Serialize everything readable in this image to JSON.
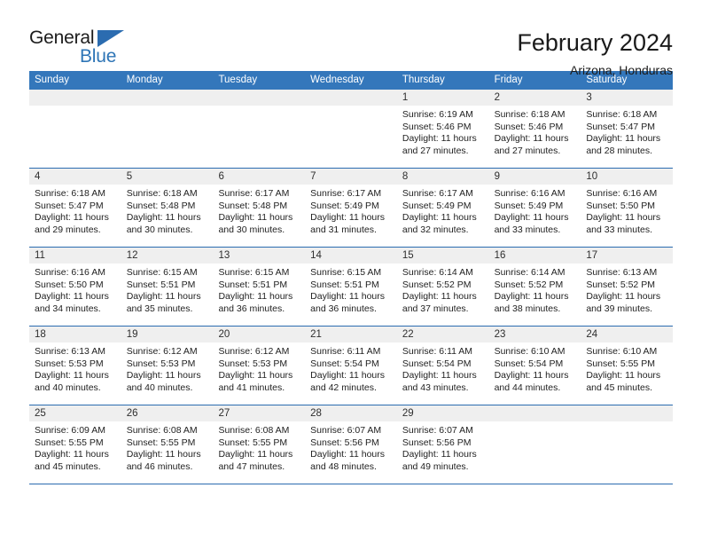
{
  "brand": {
    "name_part1": "General",
    "name_part2": "Blue",
    "triangle_color": "#2b6cb0",
    "blue_color": "#2e75b6"
  },
  "header": {
    "title": "February 2024",
    "subtitle": "Arizona, Honduras"
  },
  "theme": {
    "header_bar": "#3477bb",
    "row_divider": "#2b6cb0",
    "date_band": "#efefef",
    "text": "#222222"
  },
  "weekdays": [
    "Sunday",
    "Monday",
    "Tuesday",
    "Wednesday",
    "Thursday",
    "Friday",
    "Saturday"
  ],
  "labels": {
    "sunrise_prefix": "Sunrise:",
    "sunset_prefix": "Sunset:",
    "daylight_prefix": "Daylight:"
  },
  "weeks": [
    [
      {
        "day": "",
        "empty": true
      },
      {
        "day": "",
        "empty": true
      },
      {
        "day": "",
        "empty": true
      },
      {
        "day": "",
        "empty": true
      },
      {
        "day": "1",
        "sunrise": "Sunrise: 6:19 AM",
        "sunset": "Sunset: 5:46 PM",
        "daylight_line1": "Daylight: 11 hours",
        "daylight_line2": "and 27 minutes."
      },
      {
        "day": "2",
        "sunrise": "Sunrise: 6:18 AM",
        "sunset": "Sunset: 5:46 PM",
        "daylight_line1": "Daylight: 11 hours",
        "daylight_line2": "and 27 minutes."
      },
      {
        "day": "3",
        "sunrise": "Sunrise: 6:18 AM",
        "sunset": "Sunset: 5:47 PM",
        "daylight_line1": "Daylight: 11 hours",
        "daylight_line2": "and 28 minutes."
      }
    ],
    [
      {
        "day": "4",
        "sunrise": "Sunrise: 6:18 AM",
        "sunset": "Sunset: 5:47 PM",
        "daylight_line1": "Daylight: 11 hours",
        "daylight_line2": "and 29 minutes."
      },
      {
        "day": "5",
        "sunrise": "Sunrise: 6:18 AM",
        "sunset": "Sunset: 5:48 PM",
        "daylight_line1": "Daylight: 11 hours",
        "daylight_line2": "and 30 minutes."
      },
      {
        "day": "6",
        "sunrise": "Sunrise: 6:17 AM",
        "sunset": "Sunset: 5:48 PM",
        "daylight_line1": "Daylight: 11 hours",
        "daylight_line2": "and 30 minutes."
      },
      {
        "day": "7",
        "sunrise": "Sunrise: 6:17 AM",
        "sunset": "Sunset: 5:49 PM",
        "daylight_line1": "Daylight: 11 hours",
        "daylight_line2": "and 31 minutes."
      },
      {
        "day": "8",
        "sunrise": "Sunrise: 6:17 AM",
        "sunset": "Sunset: 5:49 PM",
        "daylight_line1": "Daylight: 11 hours",
        "daylight_line2": "and 32 minutes."
      },
      {
        "day": "9",
        "sunrise": "Sunrise: 6:16 AM",
        "sunset": "Sunset: 5:49 PM",
        "daylight_line1": "Daylight: 11 hours",
        "daylight_line2": "and 33 minutes."
      },
      {
        "day": "10",
        "sunrise": "Sunrise: 6:16 AM",
        "sunset": "Sunset: 5:50 PM",
        "daylight_line1": "Daylight: 11 hours",
        "daylight_line2": "and 33 minutes."
      }
    ],
    [
      {
        "day": "11",
        "sunrise": "Sunrise: 6:16 AM",
        "sunset": "Sunset: 5:50 PM",
        "daylight_line1": "Daylight: 11 hours",
        "daylight_line2": "and 34 minutes."
      },
      {
        "day": "12",
        "sunrise": "Sunrise: 6:15 AM",
        "sunset": "Sunset: 5:51 PM",
        "daylight_line1": "Daylight: 11 hours",
        "daylight_line2": "and 35 minutes."
      },
      {
        "day": "13",
        "sunrise": "Sunrise: 6:15 AM",
        "sunset": "Sunset: 5:51 PM",
        "daylight_line1": "Daylight: 11 hours",
        "daylight_line2": "and 36 minutes."
      },
      {
        "day": "14",
        "sunrise": "Sunrise: 6:15 AM",
        "sunset": "Sunset: 5:51 PM",
        "daylight_line1": "Daylight: 11 hours",
        "daylight_line2": "and 36 minutes."
      },
      {
        "day": "15",
        "sunrise": "Sunrise: 6:14 AM",
        "sunset": "Sunset: 5:52 PM",
        "daylight_line1": "Daylight: 11 hours",
        "daylight_line2": "and 37 minutes."
      },
      {
        "day": "16",
        "sunrise": "Sunrise: 6:14 AM",
        "sunset": "Sunset: 5:52 PM",
        "daylight_line1": "Daylight: 11 hours",
        "daylight_line2": "and 38 minutes."
      },
      {
        "day": "17",
        "sunrise": "Sunrise: 6:13 AM",
        "sunset": "Sunset: 5:52 PM",
        "daylight_line1": "Daylight: 11 hours",
        "daylight_line2": "and 39 minutes."
      }
    ],
    [
      {
        "day": "18",
        "sunrise": "Sunrise: 6:13 AM",
        "sunset": "Sunset: 5:53 PM",
        "daylight_line1": "Daylight: 11 hours",
        "daylight_line2": "and 40 minutes."
      },
      {
        "day": "19",
        "sunrise": "Sunrise: 6:12 AM",
        "sunset": "Sunset: 5:53 PM",
        "daylight_line1": "Daylight: 11 hours",
        "daylight_line2": "and 40 minutes."
      },
      {
        "day": "20",
        "sunrise": "Sunrise: 6:12 AM",
        "sunset": "Sunset: 5:53 PM",
        "daylight_line1": "Daylight: 11 hours",
        "daylight_line2": "and 41 minutes."
      },
      {
        "day": "21",
        "sunrise": "Sunrise: 6:11 AM",
        "sunset": "Sunset: 5:54 PM",
        "daylight_line1": "Daylight: 11 hours",
        "daylight_line2": "and 42 minutes."
      },
      {
        "day": "22",
        "sunrise": "Sunrise: 6:11 AM",
        "sunset": "Sunset: 5:54 PM",
        "daylight_line1": "Daylight: 11 hours",
        "daylight_line2": "and 43 minutes."
      },
      {
        "day": "23",
        "sunrise": "Sunrise: 6:10 AM",
        "sunset": "Sunset: 5:54 PM",
        "daylight_line1": "Daylight: 11 hours",
        "daylight_line2": "and 44 minutes."
      },
      {
        "day": "24",
        "sunrise": "Sunrise: 6:10 AM",
        "sunset": "Sunset: 5:55 PM",
        "daylight_line1": "Daylight: 11 hours",
        "daylight_line2": "and 45 minutes."
      }
    ],
    [
      {
        "day": "25",
        "sunrise": "Sunrise: 6:09 AM",
        "sunset": "Sunset: 5:55 PM",
        "daylight_line1": "Daylight: 11 hours",
        "daylight_line2": "and 45 minutes."
      },
      {
        "day": "26",
        "sunrise": "Sunrise: 6:08 AM",
        "sunset": "Sunset: 5:55 PM",
        "daylight_line1": "Daylight: 11 hours",
        "daylight_line2": "and 46 minutes."
      },
      {
        "day": "27",
        "sunrise": "Sunrise: 6:08 AM",
        "sunset": "Sunset: 5:55 PM",
        "daylight_line1": "Daylight: 11 hours",
        "daylight_line2": "and 47 minutes."
      },
      {
        "day": "28",
        "sunrise": "Sunrise: 6:07 AM",
        "sunset": "Sunset: 5:56 PM",
        "daylight_line1": "Daylight: 11 hours",
        "daylight_line2": "and 48 minutes."
      },
      {
        "day": "29",
        "sunrise": "Sunrise: 6:07 AM",
        "sunset": "Sunset: 5:56 PM",
        "daylight_line1": "Daylight: 11 hours",
        "daylight_line2": "and 49 minutes."
      },
      {
        "day": "",
        "empty": true
      },
      {
        "day": "",
        "empty": true
      }
    ]
  ]
}
